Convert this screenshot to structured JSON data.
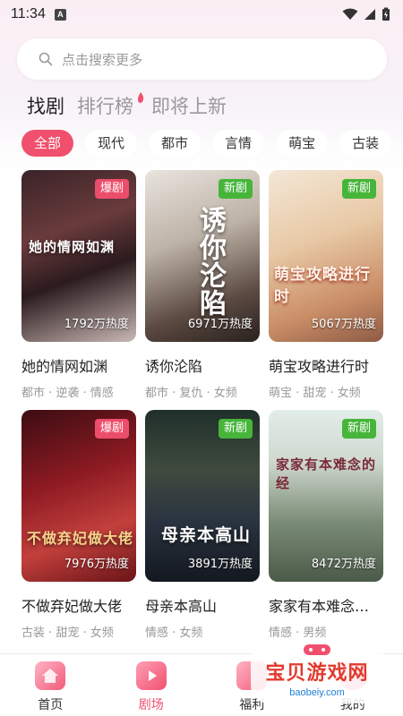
{
  "status": {
    "time": "11:34",
    "notif": "A"
  },
  "search": {
    "placeholder": "点击搜索更多"
  },
  "tabs": [
    {
      "label": "找剧",
      "active": true
    },
    {
      "label": "排行榜",
      "active": false
    },
    {
      "label": "即将上新",
      "active": false
    }
  ],
  "chips": [
    {
      "label": "全部",
      "active": true
    },
    {
      "label": "现代"
    },
    {
      "label": "都市"
    },
    {
      "label": "言情"
    },
    {
      "label": "萌宝"
    },
    {
      "label": "古装"
    }
  ],
  "cards": [
    {
      "title": "她的情网如渊",
      "tags": "都市 · 逆袭 · 情感",
      "badge": "爆剧",
      "heat": "1792万热度",
      "poster_text": "她的情网如渊"
    },
    {
      "title": "诱你沦陷",
      "tags": "都市 · 复仇 · 女频",
      "badge": "新剧",
      "heat": "6971万热度",
      "poster_text": "诱你沦陷"
    },
    {
      "title": "萌宝攻略进行时",
      "tags": "萌宝 · 甜宠 · 女频",
      "badge": "新剧",
      "heat": "5067万热度",
      "poster_text": "萌宝攻略进行时"
    },
    {
      "title": "不做弃妃做大佬",
      "tags": "古装 · 甜宠 · 女频",
      "badge": "爆剧",
      "heat": "7976万热度",
      "poster_text": "不做弃妃做大佬"
    },
    {
      "title": "母亲本高山",
      "tags": "情感 · 女频",
      "badge": "新剧",
      "heat": "3891万热度",
      "poster_text": "母亲本高山"
    },
    {
      "title": "家家有本难念…",
      "tags": "情感 · 男频",
      "badge": "新剧",
      "heat": "8472万热度",
      "poster_text": "家家有本难念的经"
    }
  ],
  "nav": [
    {
      "label": "首页"
    },
    {
      "label": "剧场",
      "active": true
    },
    {
      "label": "福利"
    },
    {
      "label": "我的"
    }
  ],
  "watermark": {
    "title": "宝贝游戏网",
    "url": "baobeiy.com"
  },
  "colors": {
    "accent": "#f0506d",
    "hot_badge": "#ec4d6b",
    "new_badge": "#46b53a"
  }
}
